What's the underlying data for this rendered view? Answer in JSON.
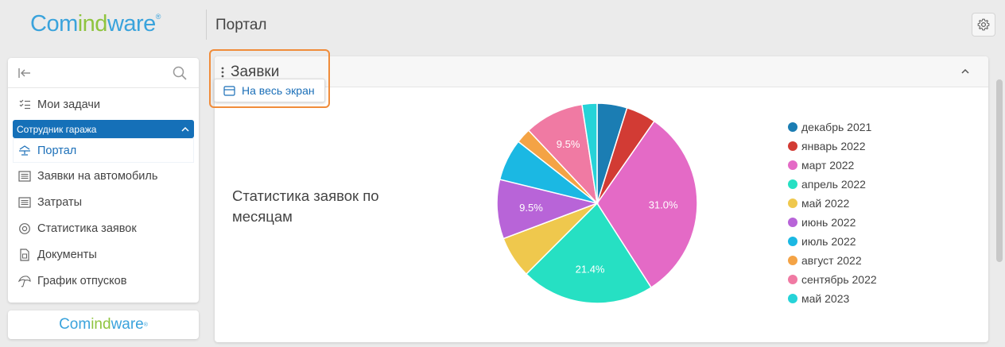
{
  "header": {
    "logo": {
      "part1": "Com",
      "part2": "ind",
      "part3": "ware",
      "mark": "®"
    },
    "page_title": "Портал",
    "settings_icon": "gear-icon"
  },
  "sidebar": {
    "collapse_icon": "collapse-left-icon",
    "search_icon": "search-icon",
    "my_tasks": "Мои задачи",
    "group_label": "Сотрудник гаража",
    "items": [
      {
        "label": "Портал",
        "icon": "portal-icon",
        "active": true
      },
      {
        "label": "Заявки на автомобиль",
        "icon": "list-icon"
      },
      {
        "label": "Затраты",
        "icon": "list-icon"
      },
      {
        "label": "Статистика заявок",
        "icon": "target-icon"
      },
      {
        "label": "Документы",
        "icon": "document-icon"
      },
      {
        "label": "График отпусков",
        "icon": "umbrella-icon"
      }
    ],
    "footer_logo": {
      "part1": "Com",
      "part2": "ind",
      "part3": "ware",
      "mark": "®"
    }
  },
  "widget": {
    "title": "Заявки",
    "fullscreen_label": "На весь экран",
    "highlight_color": "#f08c3a"
  },
  "chart_data": {
    "type": "pie",
    "title": "Статистика заявок по месяцам",
    "legend_position": "right",
    "categories": [
      "декабрь 2021",
      "январь 2022",
      "март 2022",
      "апрель 2022",
      "май 2022",
      "июнь 2022",
      "июль 2022",
      "август 2022",
      "сентябрь 2022",
      "май 2023"
    ],
    "values": [
      4.8,
      4.8,
      31.0,
      21.4,
      6.7,
      9.5,
      6.7,
      2.4,
      9.5,
      2.4
    ],
    "colors": [
      "#1b7db3",
      "#d23b34",
      "#e46ac6",
      "#26e0c3",
      "#efc84d",
      "#b864d8",
      "#1bb8e3",
      "#f4a345",
      "#f07aa3",
      "#26d3d8"
    ],
    "data_labels": [
      "",
      "",
      "31.0%",
      "21.4%",
      "",
      "9.5%",
      "",
      "",
      "9.5%",
      ""
    ]
  }
}
